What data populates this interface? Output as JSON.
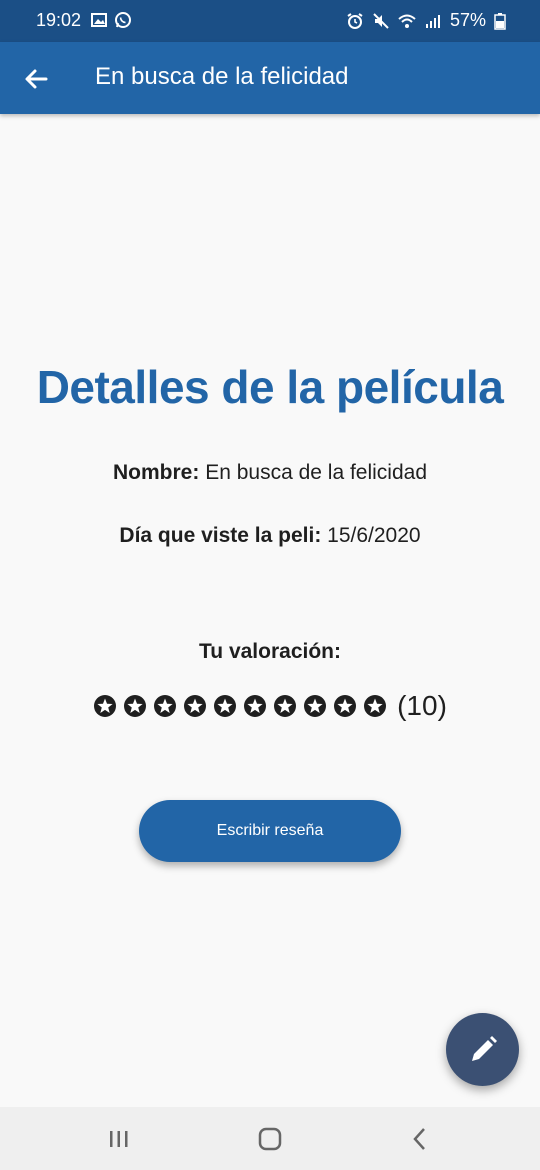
{
  "status_bar": {
    "time": "19:02",
    "battery": "57%",
    "icons": [
      "image-icon",
      "whatsapp-icon",
      "alarm-icon",
      "mute-icon",
      "wifi-icon",
      "signal-icon",
      "battery-icon"
    ]
  },
  "app_bar": {
    "back_icon": "arrow-back-icon",
    "title": "En busca de la felicidad"
  },
  "details": {
    "heading": "Detalles de la película",
    "name_label": "Nombre:",
    "name_value": "En busca de la felicidad",
    "date_label": "Día que viste la peli:",
    "date_value": "15/6/2020",
    "rating_label": "Tu valoración:",
    "rating_value": 10,
    "rating_text": "(10)",
    "star_icon": "star-circle-icon"
  },
  "actions": {
    "write_review_label": "Escribir reseña",
    "edit_fab_icon": "pencil-icon"
  },
  "nav_bar": {
    "icons": [
      "recents-icon",
      "home-icon",
      "back-nav-icon"
    ]
  },
  "colors": {
    "status_bar": "#1b4f86",
    "app_bar": "#2265a7",
    "accent": "#2265a7",
    "fab": "#3b5073",
    "background": "#f9f9f9"
  }
}
